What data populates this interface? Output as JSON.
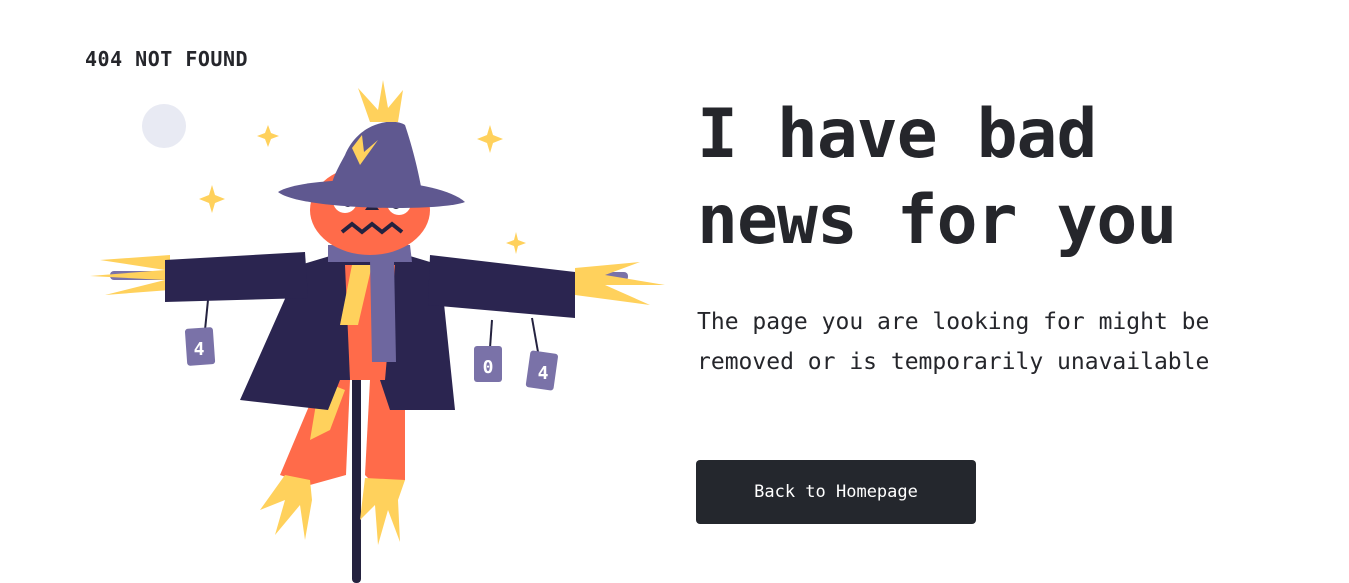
{
  "brand": {
    "label": "404 NOT FOUND"
  },
  "hero": {
    "headline_line1": "I have bad",
    "headline_line2": "news for you",
    "message_line1": "The page you are looking for might be",
    "message_line2": "removed or is temporarily unavailable"
  },
  "actions": {
    "home_button_label": "Back to Homepage"
  },
  "illustration": {
    "subject": "scarecrow",
    "cans": [
      "4",
      "0",
      "4"
    ],
    "colors": {
      "coat": "#2b2550",
      "hat": "#5f5890",
      "head": "#ff6b4a",
      "straw": "#ffd15c",
      "scarf": "#6e679f",
      "moon": "#e8eaf3",
      "pole": "#24223f"
    }
  }
}
